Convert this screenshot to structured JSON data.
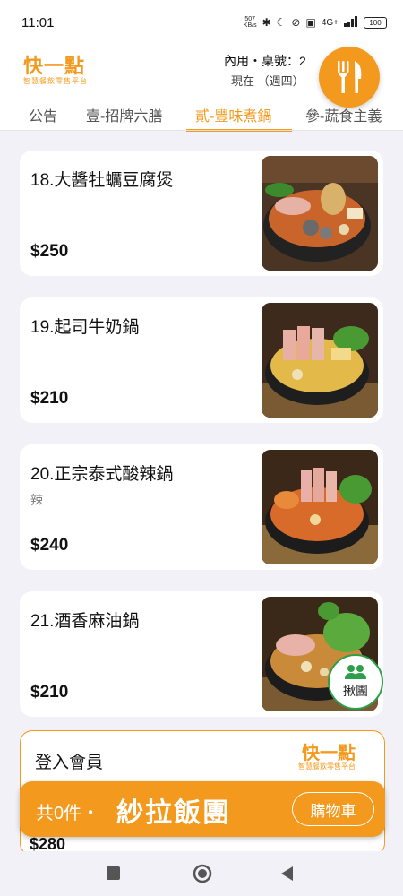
{
  "status": {
    "time": "11:01",
    "net_speed": "507",
    "net_unit": "KB/s",
    "signal": "4G+",
    "battery": "100"
  },
  "header": {
    "logo": "快一點",
    "logo_sub": "智慧餐飲零售平台",
    "dine_mode": "內用・桌號：2",
    "time_info": "現在 （週四）"
  },
  "tabs": [
    {
      "label": "公告"
    },
    {
      "label": "壹-招牌六膳"
    },
    {
      "label": "貳-豐味煮鍋"
    },
    {
      "label": "參-蔬食主義"
    }
  ],
  "menu": [
    {
      "name": "18.大醬牡蠣豆腐煲",
      "tag": "",
      "price": "$250"
    },
    {
      "name": "19.起司牛奶鍋",
      "tag": "",
      "price": "$210"
    },
    {
      "name": "20.正宗泰式酸辣鍋",
      "tag": "辣",
      "price": "$240"
    },
    {
      "name": "21.酒香麻油鍋",
      "tag": "",
      "price": "$210"
    }
  ],
  "group_button": {
    "label": "揪團"
  },
  "login": {
    "title": "登入會員",
    "logo": "快一點",
    "logo_sub": "智慧餐飲零售平台",
    "next_price": "$280"
  },
  "cart": {
    "count_text": "共0件・",
    "brand": "紗拉飯團",
    "button": "購物車"
  },
  "colors": {
    "accent": "#f39a1e",
    "group_green": "#2e9e4a"
  }
}
